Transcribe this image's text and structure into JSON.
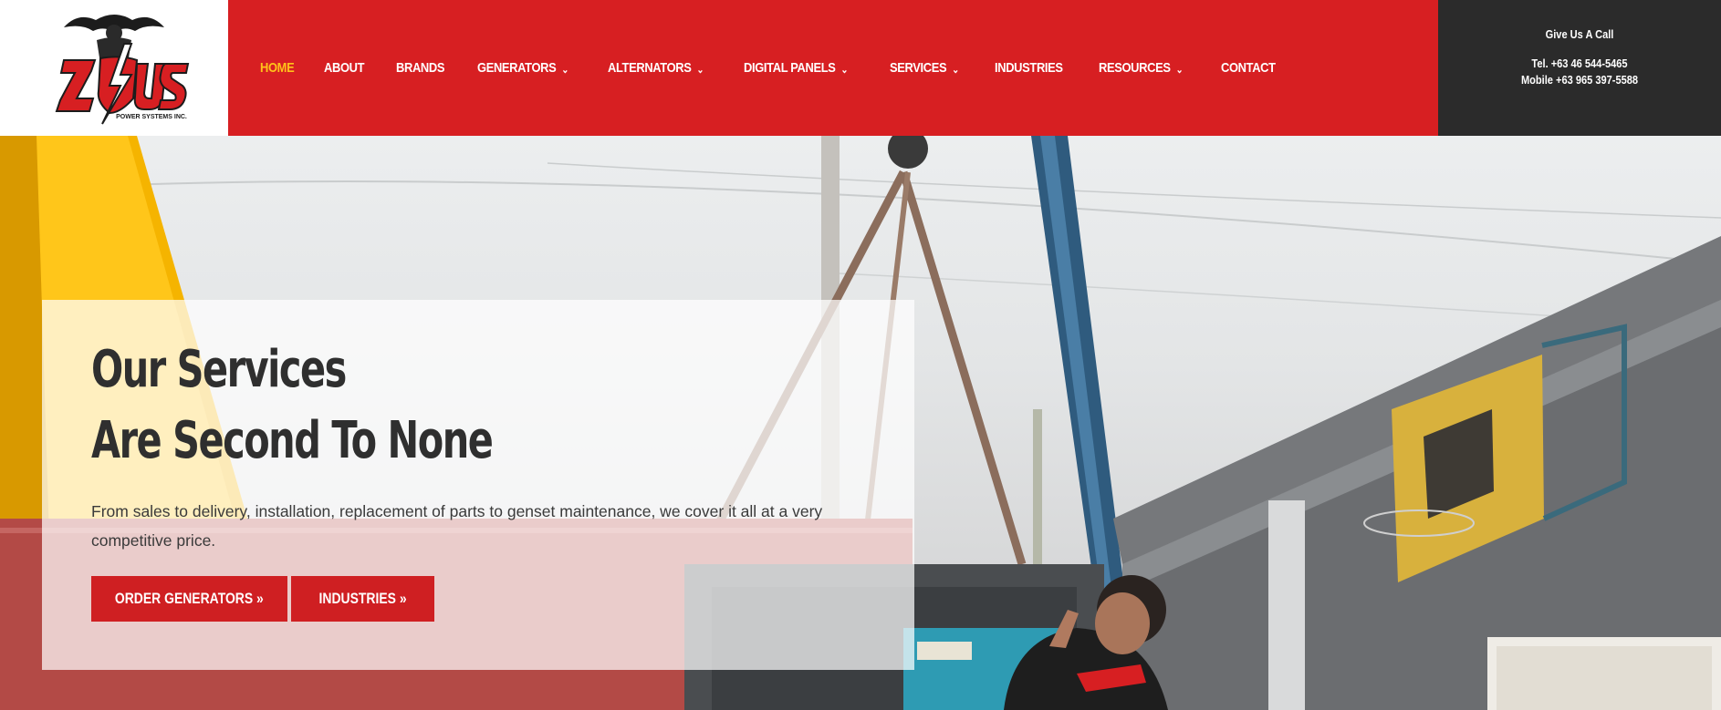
{
  "brand": {
    "logo_letters": "Z US",
    "logo_tagline": "POWER SYSTEMS INC."
  },
  "nav": {
    "items": [
      {
        "label": "HOME",
        "active": true,
        "dropdown": false
      },
      {
        "label": "ABOUT",
        "active": false,
        "dropdown": false
      },
      {
        "label": "BRANDS",
        "active": false,
        "dropdown": false
      },
      {
        "label": "GENERATORS",
        "active": false,
        "dropdown": true
      },
      {
        "label": "ALTERNATORS",
        "active": false,
        "dropdown": true
      },
      {
        "label": "DIGITAL PANELS",
        "active": false,
        "dropdown": true
      },
      {
        "label": "SERVICES",
        "active": false,
        "dropdown": true
      },
      {
        "label": "INDUSTRIES",
        "active": false,
        "dropdown": false
      },
      {
        "label": "RESOURCES",
        "active": false,
        "dropdown": true
      },
      {
        "label": "CONTACT",
        "active": false,
        "dropdown": false
      }
    ],
    "chevron": "⌄"
  },
  "contact": {
    "title": "Give Us A Call",
    "tel": "Tel. +63 46 544-5465",
    "mobile": "Mobile +63 965 397-5588"
  },
  "hero": {
    "title_line1": "Our Services",
    "title_line2": "Are Second To None",
    "description": "From sales to delivery, installation, replacement of parts to genset maintenance, we cover it all at a very competitive price.",
    "order_button": "ORDER GENERATORS »",
    "industries_button": "INDUSTRIES »"
  },
  "colors": {
    "header_red": "#d71f22",
    "contact_dark": "#2b2b2b",
    "active_nav": "#ffc21a",
    "button_red": "#cf1f22"
  }
}
